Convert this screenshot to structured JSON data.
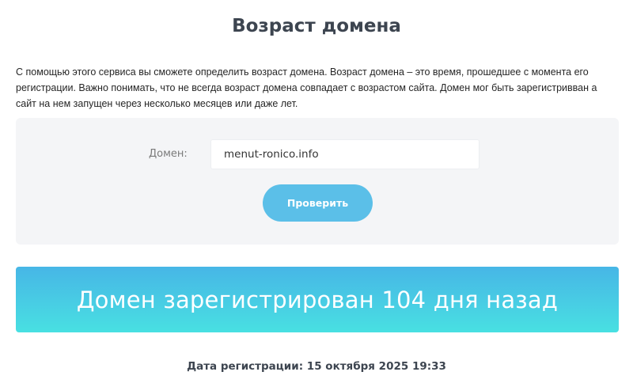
{
  "page": {
    "title": "Возраст домена",
    "description": "С помощью этого сервиса вы сможете определить возраст домена. Возраст домена – это время, прошедшее с момента его регистрации. Важно понимать, что не всегда возраст домена совпадает с возрастом сайта. Домен мог быть зарегистривван а сайт на нем запущен через несколько месяцев или даже лет."
  },
  "form": {
    "domain_label": "Домен:",
    "domain_value": "menut-ronico.info",
    "submit_label": "Проверить"
  },
  "result": {
    "message": "Домен зарегистрирован 104 дня назад",
    "registration_date": "Дата регистрации: 15 октября 2025 19:33"
  },
  "colors": {
    "button": "#5bbfe8",
    "banner_top": "#47b6e6",
    "banner_bottom": "#48e0e2",
    "panel_bg": "#f4f5f7",
    "heading": "#3d4550"
  }
}
